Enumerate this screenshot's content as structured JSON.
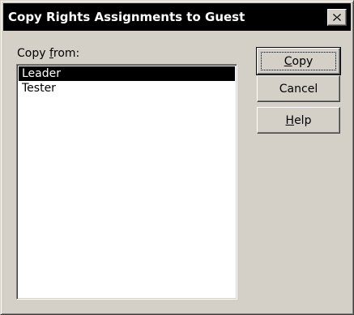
{
  "dialog": {
    "title": "Copy Rights Assignments to Guest"
  },
  "copy_from": {
    "label_prefix": "Copy ",
    "label_mnemonic": "f",
    "label_suffix": "rom:",
    "items": [
      {
        "label": "Leader",
        "selected": true
      },
      {
        "label": "Tester",
        "selected": false
      }
    ]
  },
  "buttons": {
    "copy": {
      "mnemonic": "C",
      "rest": "opy"
    },
    "cancel": {
      "label": "Cancel"
    },
    "help": {
      "mnemonic": "H",
      "rest": "elp"
    }
  },
  "colors": {
    "face": "#d4d0c8",
    "titlebar": "#000000",
    "selection": "#000000"
  },
  "icons": {
    "close": "close-icon"
  }
}
